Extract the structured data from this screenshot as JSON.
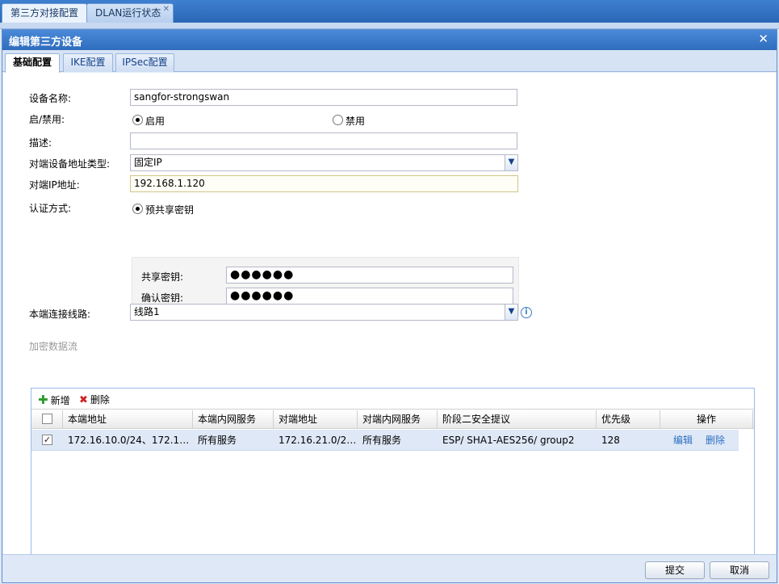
{
  "top_tabs": [
    {
      "label": "第三方对接配置"
    },
    {
      "label": "DLAN运行状态"
    }
  ],
  "dialog": {
    "title": "编辑第三方设备",
    "close_icon": "close-icon"
  },
  "inner_tabs": [
    {
      "label": "基础配置"
    },
    {
      "label": "IKE配置"
    },
    {
      "label": "IPSec配置"
    }
  ],
  "form": {
    "device_name_label": "设备名称:",
    "device_name_value": "sangfor-strongswan",
    "enable_label": "启/禁用:",
    "enable_on": "启用",
    "enable_off": "禁用",
    "enable_state": "启用",
    "desc_label": "描述:",
    "desc_value": "",
    "addr_type_label": "对端设备地址类型:",
    "addr_type_value": "固定IP",
    "peer_ip_label": "对端IP地址:",
    "peer_ip_value": "192.168.1.120",
    "auth_label": "认证方式:",
    "auth_option": "预共享密钥",
    "shared_key_label": "共享密钥:",
    "shared_key_value": "●●●●●●",
    "confirm_key_label": "确认密钥:",
    "confirm_key_value": "●●●●●●",
    "line_label": "本端连接线路:",
    "line_value": "线路1"
  },
  "flow": {
    "section_title": "加密数据流",
    "add_label": "新增",
    "delete_label": "删除",
    "columns": [
      "本端地址",
      "本端内网服务",
      "对端地址",
      "对端内网服务",
      "阶段二安全提议",
      "优先级",
      "操作"
    ],
    "rows": [
      {
        "checked": true,
        "local_addr": "172.16.10.0/24、172.16....",
        "local_service": "所有服务",
        "peer_addr": "172.16.21.0/24...",
        "peer_service": "所有服务",
        "proposal": "ESP/ SHA1-AES256/ group2",
        "priority": "128",
        "edit": "编辑",
        "delete": "删除"
      }
    ]
  },
  "footer": {
    "submit_label": "提交",
    "cancel_label": "取消"
  }
}
